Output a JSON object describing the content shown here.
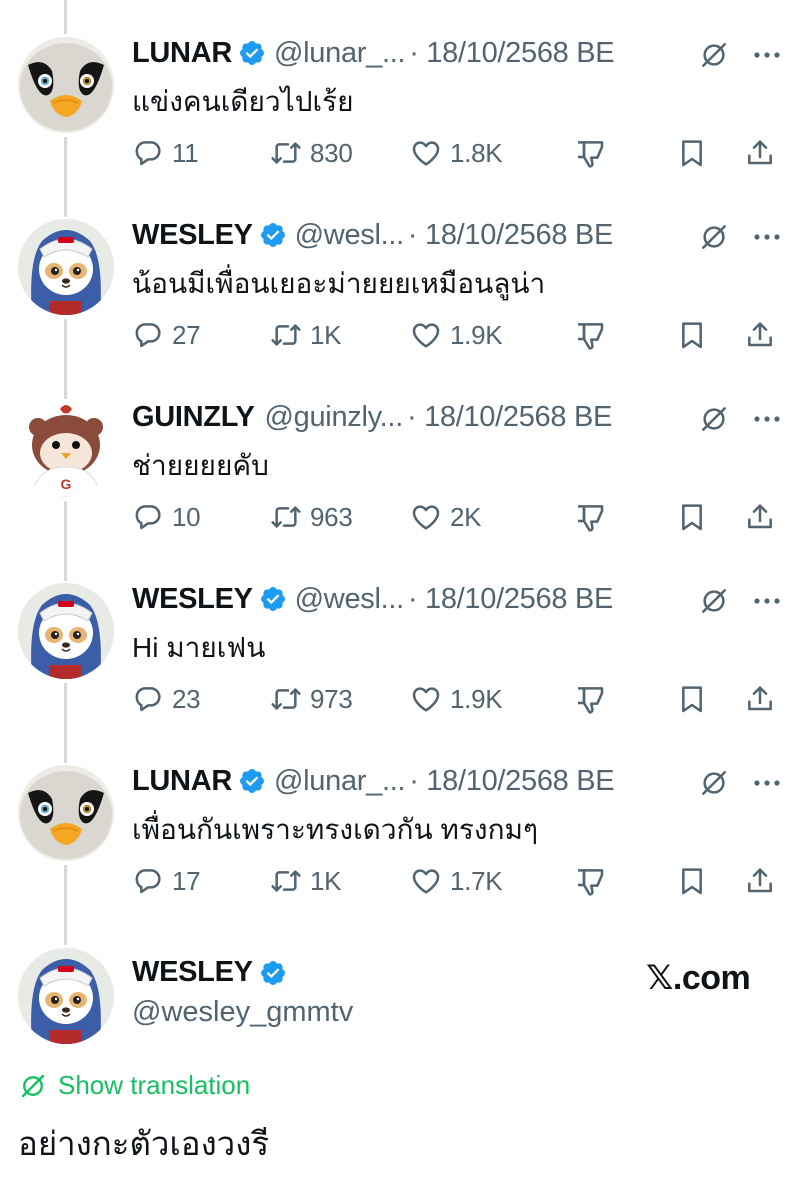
{
  "tweets": [
    {
      "name": "LUNAR",
      "handle": "@lunar_...",
      "date": "· 18/10/2568 BE",
      "text": "แข่งคนเดียวไปเร้ย",
      "replies": "11",
      "reposts": "830",
      "likes": "1.8K",
      "avatar": "penguin-mascot"
    },
    {
      "name": "WESLEY",
      "handle": "@wesl...",
      "date": "· 18/10/2568 BE",
      "text": "น้อนมีเพื่อนเยอะม่ายยยเหมือนลูน่า",
      "replies": "27",
      "reposts": "1K",
      "likes": "1.9K",
      "avatar": "dog-mascot"
    },
    {
      "name": "GUINZLY",
      "handle": "@guinzly...",
      "date": "· 18/10/2568 BE",
      "text": "ช่ายยยยคับ",
      "replies": "10",
      "reposts": "963",
      "likes": "2K",
      "avatar": "bird-mascot"
    },
    {
      "name": "WESLEY",
      "handle": "@wesl...",
      "date": "· 18/10/2568 BE",
      "text": "Hi มายเฟน",
      "replies": "23",
      "reposts": "973",
      "likes": "1.9K",
      "avatar": "dog-mascot"
    },
    {
      "name": "LUNAR",
      "handle": "@lunar_...",
      "date": "· 18/10/2568 BE",
      "text": "เพื่อนกันเพราะทรงเดวกัน ทรงกมๆ",
      "replies": "17",
      "reposts": "1K",
      "likes": "1.7K",
      "avatar": "penguin-mascot"
    }
  ],
  "main_tweet": {
    "name": "WESLEY",
    "handle": "@wesley_gmmtv",
    "watermark": "𝕏.com",
    "translate_label": "Show translation",
    "text": "อย่างกะตัวเองวงรี",
    "avatar": "dog-mascot"
  },
  "colors": {
    "verified": "#1d9bf0",
    "secondary_text": "#536471",
    "thread_line": "#cfd9de",
    "translate": "#17bf63"
  },
  "icons": [
    "verified-badge-icon",
    "grok-icon",
    "more-icon",
    "reply-icon",
    "repost-icon",
    "like-icon",
    "dislike-icon",
    "bookmark-icon",
    "share-icon",
    "translate-icon"
  ]
}
